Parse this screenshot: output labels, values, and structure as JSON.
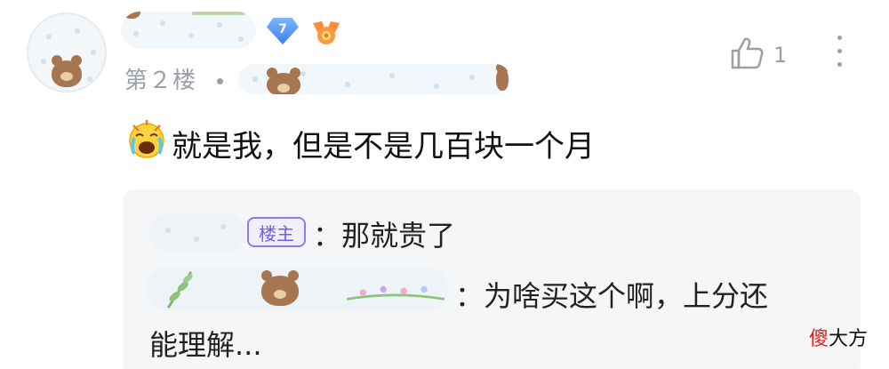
{
  "post": {
    "floor_label": "第２楼",
    "level": "7",
    "like_count": "1"
  },
  "comment": {
    "text": "就是我，但是不是几百块一个月"
  },
  "replies": [
    {
      "badge": "楼主",
      "text": "：那就贵了"
    },
    {
      "text": "：为啥买这个啊，上分还",
      "text_cont": "能理解..."
    }
  ],
  "watermark": {
    "part1": "傻",
    "part2": "大方"
  },
  "colors": {
    "muted": "#9aa0a6",
    "op_badge": "#6f5cf0",
    "reply_bg": "#f5f6f8"
  },
  "icons": [
    "avatar-bear",
    "level-gem-icon",
    "medal-icon",
    "like-icon",
    "more-icon",
    "crying-emoji-icon"
  ]
}
